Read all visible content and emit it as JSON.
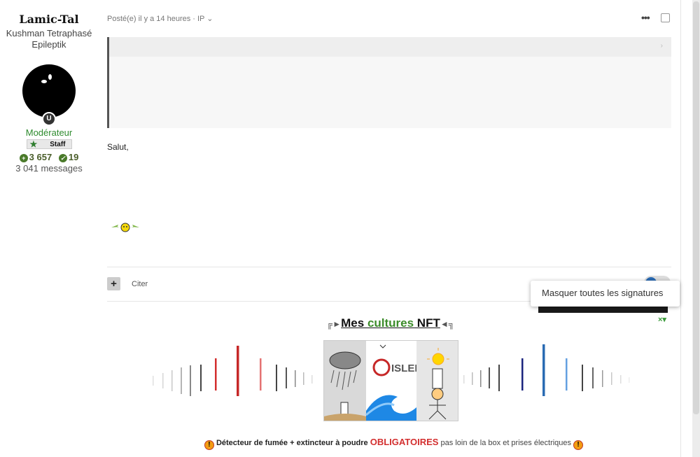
{
  "author": {
    "name": "Lamic-Tal",
    "title_line1": "Kushman Tetraphasé",
    "title_line2": "Epileptik",
    "role": "Modérateur",
    "badge": "Staff",
    "reputation": "3 657",
    "solutions": "19",
    "messages": "3 041 messages"
  },
  "post": {
    "meta": "Posté(e) il y a 14 heures · IP ⌄",
    "more_icon": "•••",
    "body_text": "Salut,",
    "quote_action": "Citer"
  },
  "tooltip": {
    "text": "Masquer toutes les signatures"
  },
  "signature": {
    "title_part1": "Mes ",
    "title_part2": "cultures",
    "title_part3": " NFT",
    "deco_left": "╔►",
    "deco_right": "◄╗",
    "image_text": "ISLED",
    "warning_bold": "Détecteur de fumée + extincteur à poudre",
    "warning_red": "OBLIGATOIRES",
    "warning_rest": "pas loin de la box et prises électriques"
  },
  "colors": {
    "role_green": "#2e8b2e",
    "accent_blue": "#2a6bb3",
    "warning_red": "#d32f2f"
  }
}
